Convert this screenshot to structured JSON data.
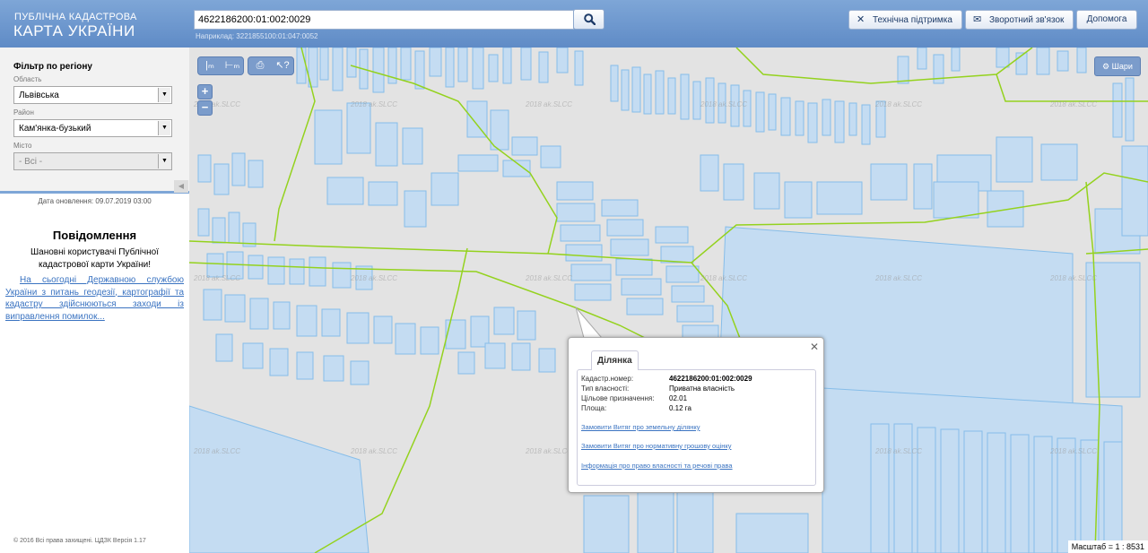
{
  "header": {
    "logo_line1": "ПУБЛІЧНА КАДАСТРОВА",
    "logo_line2": "КАРТА УКРАЇНИ",
    "search_value": "4622186200:01:002:0029",
    "search_hint": "Наприклад: 3221855100:01:047:0052",
    "buttons": {
      "support": "Технічна підтримка",
      "feedback": "Зворотний зв'язок",
      "help": "Допомога"
    }
  },
  "sidebar": {
    "filter_title": "Фільтр по регіону",
    "region_label": "Область",
    "region_value": "Львівська",
    "district_label": "Район",
    "district_value": "Кам'янка-бузький",
    "city_label": "Місто",
    "city_value": "- Всі -",
    "update_date": "Дата оновлення: 09.07.2019 03:00",
    "notice_title": "Повідомлення",
    "notice_greeting": "Шановні користувачі Публічної кадастрової карти України!",
    "notice_link": "На сьогодні Державною службою України з питань геодезії, картографії та кадастру здійснюються заходи із виправлення помилок...",
    "copyright": "© 2016 Всі права захищені. ЦДЗК Версія 1.17"
  },
  "map": {
    "layers_button": "Шари",
    "zoom_in": "+",
    "zoom_out": "−",
    "scale_text": "Масштаб = 1 : 8531",
    "watermark": "2018 ak.SLCC",
    "colors": {
      "parcel_fill": "#c4dcf2",
      "parcel_stroke": "#86bde9",
      "boundary": "#94d21e",
      "background": "#e3e3e3"
    }
  },
  "popup": {
    "tab_label": "Ділянка",
    "fields": [
      {
        "key": "Кадастр.номер:",
        "value": "4622186200:01:002:0029"
      },
      {
        "key": "Тип власності:",
        "value": "Приватна власність"
      },
      {
        "key": "Цільове призначення:",
        "value": "02.01"
      },
      {
        "key": "Площа:",
        "value": "0.12 га"
      }
    ],
    "links": [
      "Замовити Витяг про земельну ділянку",
      "Замовити Витяг про нормативну грошову оцінку",
      "Інформація про право власності та речові права"
    ]
  }
}
